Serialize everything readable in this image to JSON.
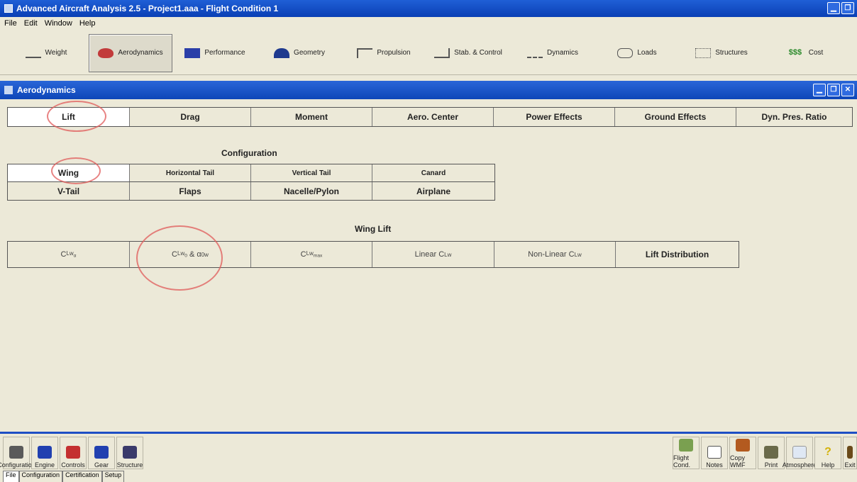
{
  "window": {
    "title": "Advanced Aircraft Analysis 2.5 - Project1.aaa - Flight Condition 1"
  },
  "menu": [
    "File",
    "Edit",
    "Window",
    "Help"
  ],
  "modules": [
    "Weight",
    "Aerodynamics",
    "Performance",
    "Geometry",
    "Propulsion",
    "Stab. & Control",
    "Dynamics",
    "Loads",
    "Structures",
    "Cost"
  ],
  "panel": {
    "title": "Aerodynamics"
  },
  "aero_tabs": [
    "Lift",
    "Drag",
    "Moment",
    "Aero. Center",
    "Power Effects",
    "Ground Effects",
    "Dyn. Pres. Ratio"
  ],
  "configuration": {
    "heading": "Configuration",
    "row1": [
      "Wing",
      "Horizontal Tail",
      "Vertical Tail",
      "Canard"
    ],
    "row2": [
      "V-Tail",
      "Flaps",
      "Nacelle/Pylon",
      "Airplane"
    ]
  },
  "wing_lift": {
    "heading": "Wing Lift",
    "items": [
      {
        "main": "C",
        "sub": "Lw",
        "sub2": "α"
      },
      {
        "main": "C",
        "sub": "Lw",
        "sub2": "0",
        "extra": "& α",
        "extra_sub": "0w"
      },
      {
        "main": "C",
        "sub": "Lw",
        "sub2": "max"
      },
      {
        "main": "Linear C",
        "sub": "Lw"
      },
      {
        "main": "Non-Linear C",
        "sub": "Lw"
      },
      {
        "main": "Lift Distribution"
      }
    ]
  },
  "bottom_left_tools": [
    "Configuration",
    "Engine",
    "Controls",
    "Gear",
    "Structure"
  ],
  "bottom_right_tools": [
    "Flight Cond.",
    "Notes",
    "Copy WMF",
    "Print",
    "Atmosphere",
    "Help",
    "Exit"
  ],
  "status_tabs": [
    "File",
    "Configuration",
    "Certification",
    "Setup"
  ],
  "colors": {
    "titlebar": "#0a3fb5",
    "panelbar": "#0d46b8",
    "annotation": "#e05a5a",
    "background": "#ece9d8"
  }
}
